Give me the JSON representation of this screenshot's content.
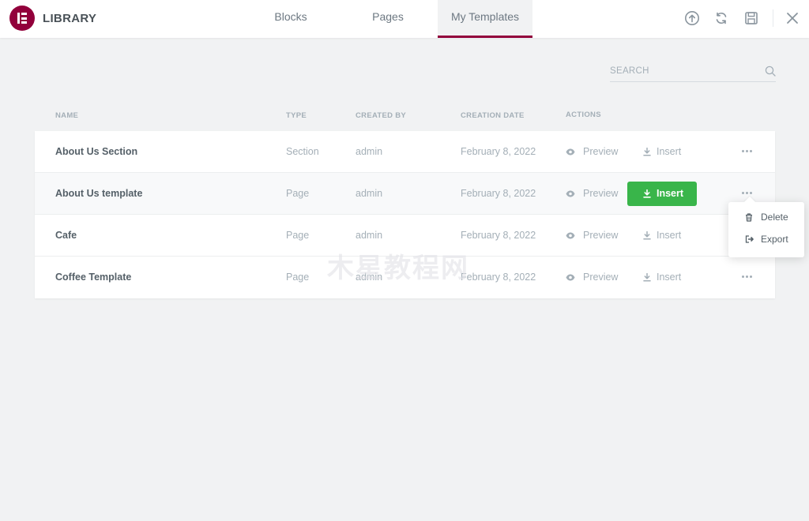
{
  "header": {
    "title": "LIBRARY",
    "tabs": [
      {
        "label": "Blocks"
      },
      {
        "label": "Pages"
      },
      {
        "label": "My Templates"
      }
    ],
    "icons": [
      "upload-icon",
      "sync-icon",
      "save-icon",
      "close-icon"
    ],
    "brand_color": "#92003b"
  },
  "search": {
    "placeholder": "SEARCH"
  },
  "table": {
    "columns": [
      "NAME",
      "TYPE",
      "CREATED BY",
      "CREATION DATE",
      "ACTIONS"
    ],
    "rows": [
      {
        "name": "About Us Section",
        "type": "Section",
        "created_by": "admin",
        "date": "February 8, 2022",
        "preview": "Preview",
        "insert": "Insert"
      },
      {
        "name": "About Us template",
        "type": "Page",
        "created_by": "admin",
        "date": "February 8, 2022",
        "preview": "Preview",
        "insert": "Insert"
      },
      {
        "name": "Cafe",
        "type": "Page",
        "created_by": "admin",
        "date": "February 8, 2022",
        "preview": "Preview",
        "insert": "Insert"
      },
      {
        "name": "Coffee Template",
        "type": "Page",
        "created_by": "admin",
        "date": "February 8, 2022",
        "preview": "Preview",
        "insert": "Insert"
      }
    ]
  },
  "dropdown": {
    "items": [
      {
        "label": "Delete",
        "icon": "trash-icon"
      },
      {
        "label": "Export",
        "icon": "export-icon"
      }
    ]
  },
  "watermark": "木星教程网",
  "colors": {
    "insert_button": "#39b54a",
    "accent": "#92003b"
  }
}
